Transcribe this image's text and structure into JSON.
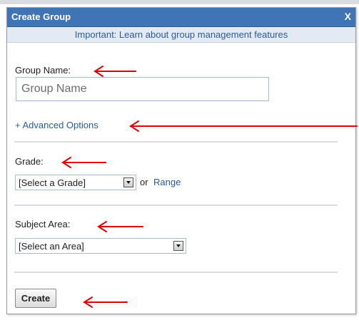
{
  "dialog": {
    "title": "Create Group",
    "close_label": "X",
    "notice": "Important: Learn about group management features"
  },
  "group_name": {
    "label": "Group Name:",
    "placeholder": "Group Name",
    "value": ""
  },
  "advanced": {
    "label": "+ Advanced Options"
  },
  "grade": {
    "label": "Grade:",
    "selected": "[Select a Grade]",
    "or_text": "or",
    "range_link": "Range"
  },
  "subject": {
    "label": "Subject Area:",
    "selected": "[Select an Area]"
  },
  "actions": {
    "create_label": "Create"
  },
  "colors": {
    "titlebar": "#3f75b7",
    "link": "#2a5aa0",
    "annotation_arrow": "#e00000"
  }
}
